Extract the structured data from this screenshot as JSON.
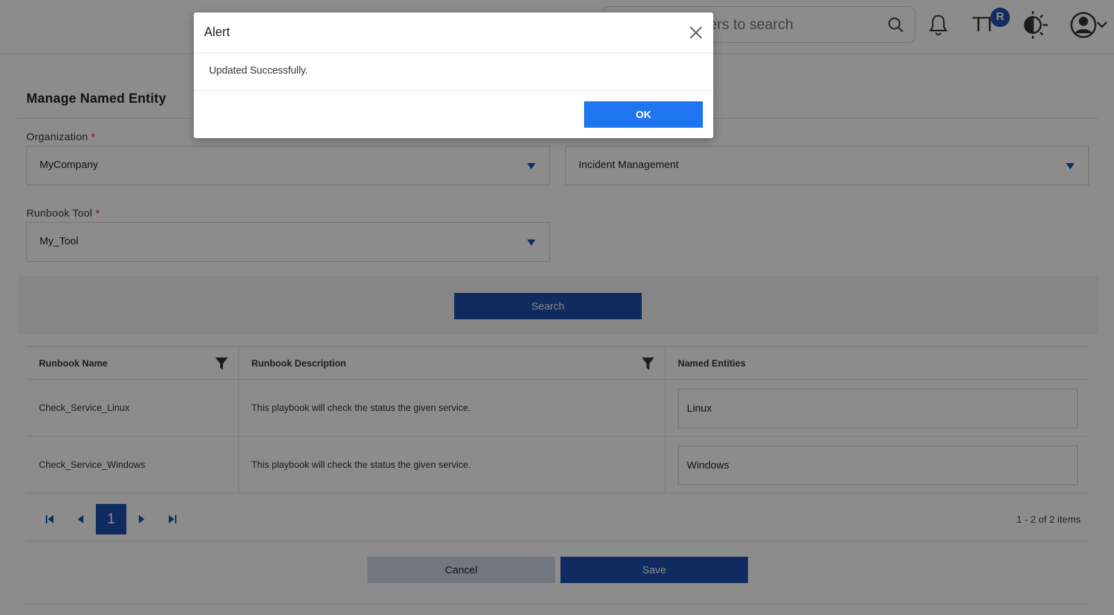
{
  "header": {
    "search_placeholder": "Type 3 characters to search",
    "notification_badge": "R",
    "font_size_label": "TT"
  },
  "page": {
    "title": "Manage Named Entity",
    "organization": {
      "label": "Organization",
      "required_mark": "*",
      "value": "MyCompany"
    },
    "category": {
      "value": "Incident Management"
    },
    "runbook_tool": {
      "label": "Runbook Tool",
      "required_mark": "*",
      "value": "My_Tool"
    },
    "search_button": "Search",
    "table": {
      "columns": [
        "Runbook Name",
        "Runbook Description",
        "Named Entities"
      ],
      "rows": [
        {
          "name": "Check_Service_Linux",
          "description": "This playbook will check the status the given service.",
          "entity": "Linux"
        },
        {
          "name": "Check_Service_Windows",
          "description": "This playbook will check the status the given service.",
          "entity": "Windows"
        }
      ]
    },
    "pager": {
      "current_page": "1",
      "items_info": "1 - 2 of 2 items"
    },
    "cancel_button": "Cancel",
    "save_button": "Save"
  },
  "modal": {
    "title": "Alert",
    "message": "Updated Successfully.",
    "ok_button": "OK"
  },
  "colors": {
    "primary": "#1e4fae",
    "ok_button": "#1f75f0",
    "cancel_button": "#cdd9e8",
    "required": "#c0392b"
  }
}
